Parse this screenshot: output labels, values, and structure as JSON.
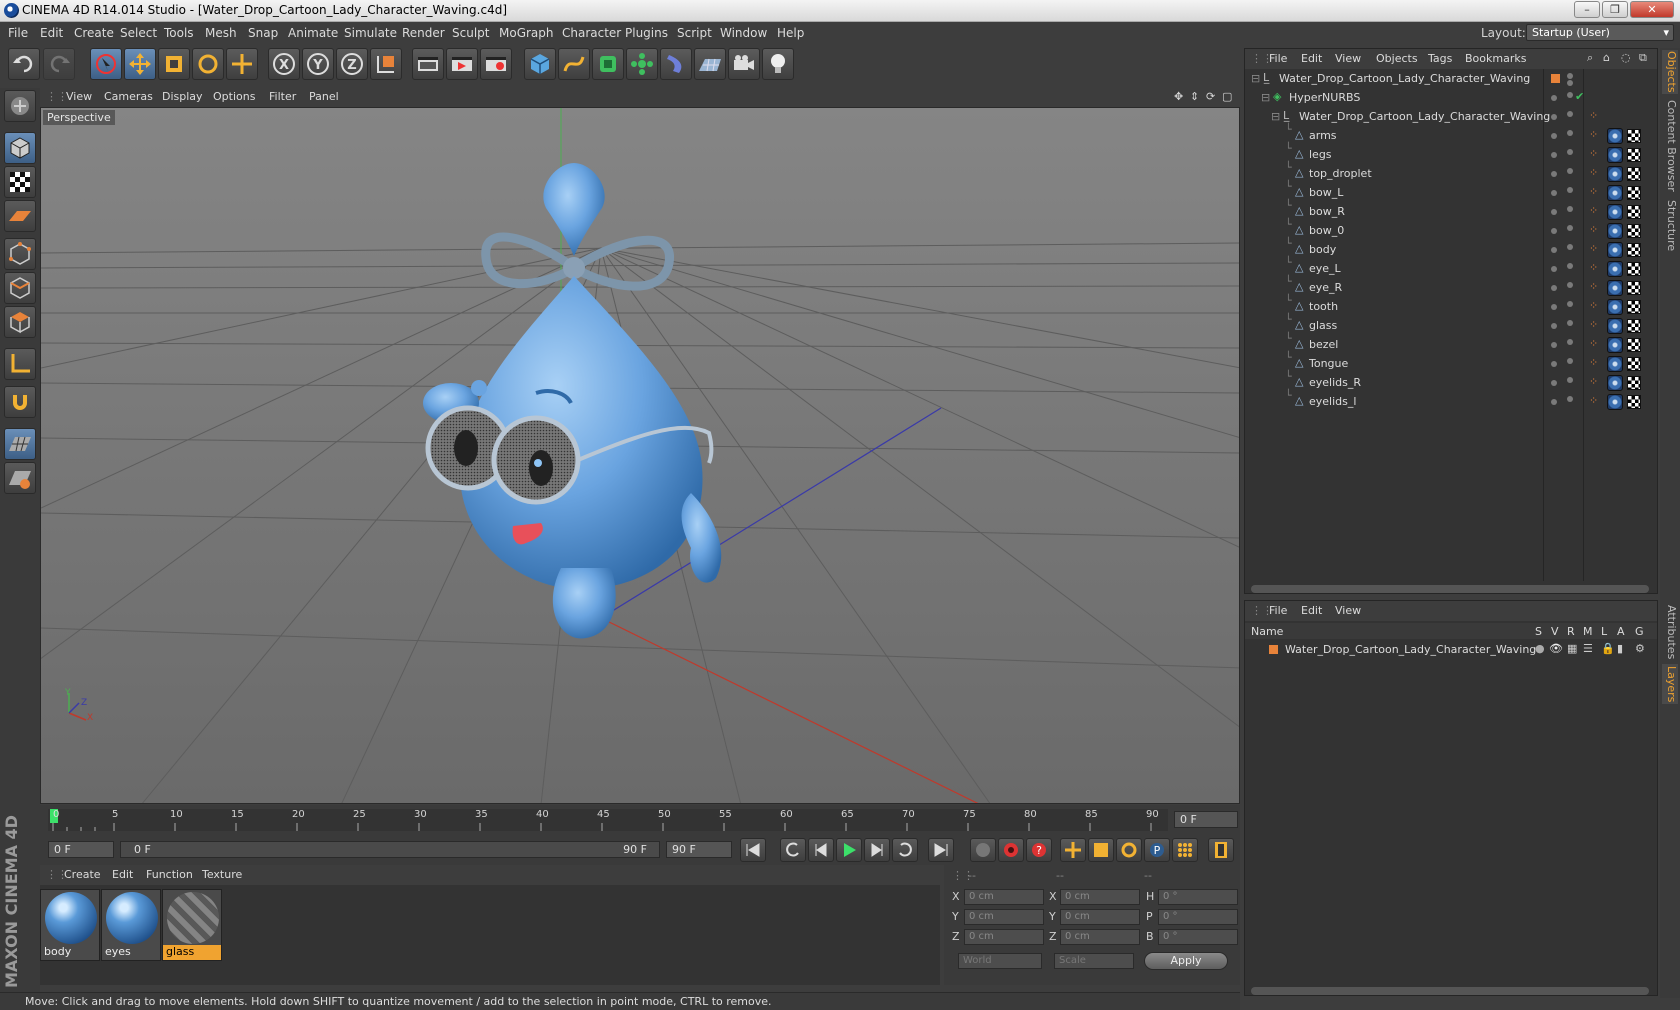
{
  "window": {
    "title": "CINEMA 4D R14.014 Studio - [Water_Drop_Cartoon_Lady_Character_Waving.c4d]"
  },
  "menubar": {
    "items": [
      "File",
      "Edit",
      "Create",
      "Select",
      "Tools",
      "Mesh",
      "Snap",
      "Animate",
      "Simulate",
      "Render",
      "Sculpt",
      "MoGraph",
      "Character",
      "Plugins",
      "Script",
      "Window",
      "Help"
    ],
    "layout_label": "Layout:",
    "layout_value": "Startup (User)"
  },
  "viewport": {
    "menu": [
      "View",
      "Cameras",
      "Display",
      "Options",
      "Filter",
      "Panel"
    ],
    "camera_label": "Perspective",
    "axis_y": "Y",
    "axis_z": "Z",
    "axis_x": "X"
  },
  "timeline": {
    "ticks": [
      "0",
      "5",
      "10",
      "15",
      "20",
      "25",
      "30",
      "35",
      "40",
      "45",
      "50",
      "55",
      "60",
      "65",
      "70",
      "75",
      "80",
      "85",
      "90"
    ],
    "current_frame_field": "0 F",
    "start_field": "0 F",
    "range_start": "0 F",
    "range_end": "90 F",
    "end_field": "90 F"
  },
  "material_manager": {
    "menu": [
      "Create",
      "Edit",
      "Function",
      "Texture"
    ],
    "materials": [
      {
        "name": "body"
      },
      {
        "name": "eyes"
      },
      {
        "name": "glass"
      }
    ]
  },
  "coordinates": {
    "header_left": "--",
    "header_mid": "--",
    "header_right": "--",
    "rows": [
      {
        "l1": "X",
        "v1": "0 cm",
        "l2": "X",
        "v2": "0 cm",
        "l3": "H",
        "v3": "0 °"
      },
      {
        "l1": "Y",
        "v1": "0 cm",
        "l2": "Y",
        "v2": "0 cm",
        "l3": "P",
        "v3": "0 °"
      },
      {
        "l1": "Z",
        "v1": "0 cm",
        "l2": "Z",
        "v2": "0 cm",
        "l3": "B",
        "v3": "0 °"
      }
    ],
    "mode1": "World",
    "mode2": "Scale",
    "apply": "Apply"
  },
  "status": {
    "text": "Move: Click and drag to move elements. Hold down SHIFT to quantize movement / add to the selection in point mode, CTRL to remove."
  },
  "object_manager": {
    "menu": [
      "File",
      "Edit",
      "View",
      "Objects",
      "Tags",
      "Bookmarks"
    ],
    "root": "Water_Drop_Cartoon_Lady_Character_Waving",
    "hypernurbs": "HyperNURBS",
    "group": "Water_Drop_Cartoon_Lady_Character_Waving",
    "children": [
      "arms",
      "legs",
      "top_droplet",
      "bow_L",
      "bow_R",
      "bow_0",
      "body",
      "eye_L",
      "eye_R",
      "tooth",
      "glass",
      "bezel",
      "Tongue",
      "eyelids_R",
      "eyelids_l"
    ]
  },
  "layer_manager": {
    "menu": [
      "File",
      "Edit",
      "View"
    ],
    "columns": [
      "Name",
      "S",
      "V",
      "R",
      "M",
      "L",
      "A",
      "G"
    ],
    "layers": [
      "Water_Drop_Cartoon_Lady_Character_Waving"
    ]
  },
  "side_tabs": [
    "Objects",
    "Content Browser",
    "Structure",
    "Attributes",
    "Layers"
  ],
  "colors": {
    "accent_orange": "#f0a330",
    "character_blue": "#6aa4e0",
    "viewport_bg": "#717171"
  }
}
